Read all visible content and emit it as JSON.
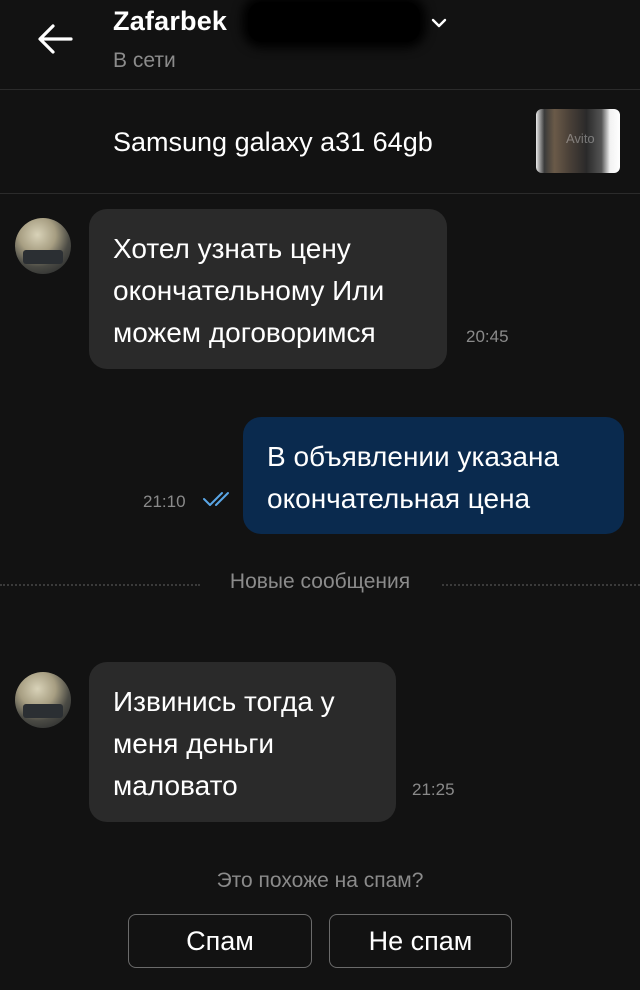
{
  "header": {
    "name": "Zafarbek",
    "status": "В сети",
    "back_icon": "arrow-left-icon",
    "chevron_icon": "chevron-down-icon"
  },
  "listing": {
    "title": "Samsung galaxy a31 64gb",
    "thumb_watermark": "Avito"
  },
  "messages": [
    {
      "direction": "in",
      "text": "Хотел узнать цену окончательному Или можем договоримся",
      "time": "20:45"
    },
    {
      "direction": "out",
      "text": "В объявлении указана окончательная цена",
      "time": "21:10",
      "read": true
    },
    {
      "direction": "in",
      "text": "Извинись тогда у меня деньги маловато",
      "time": "21:25"
    }
  ],
  "divider": {
    "label": "Новые сообщения"
  },
  "spam": {
    "question": "Это похоже на спам?",
    "spam_label": "Спам",
    "not_spam_label": "Не спам"
  },
  "colors": {
    "background": "#121212",
    "incoming_bubble": "#2a2a2a",
    "outgoing_bubble": "#0a2a4e",
    "read_ticks": "#5aa6e6",
    "muted_text": "#8b8b8b"
  }
}
